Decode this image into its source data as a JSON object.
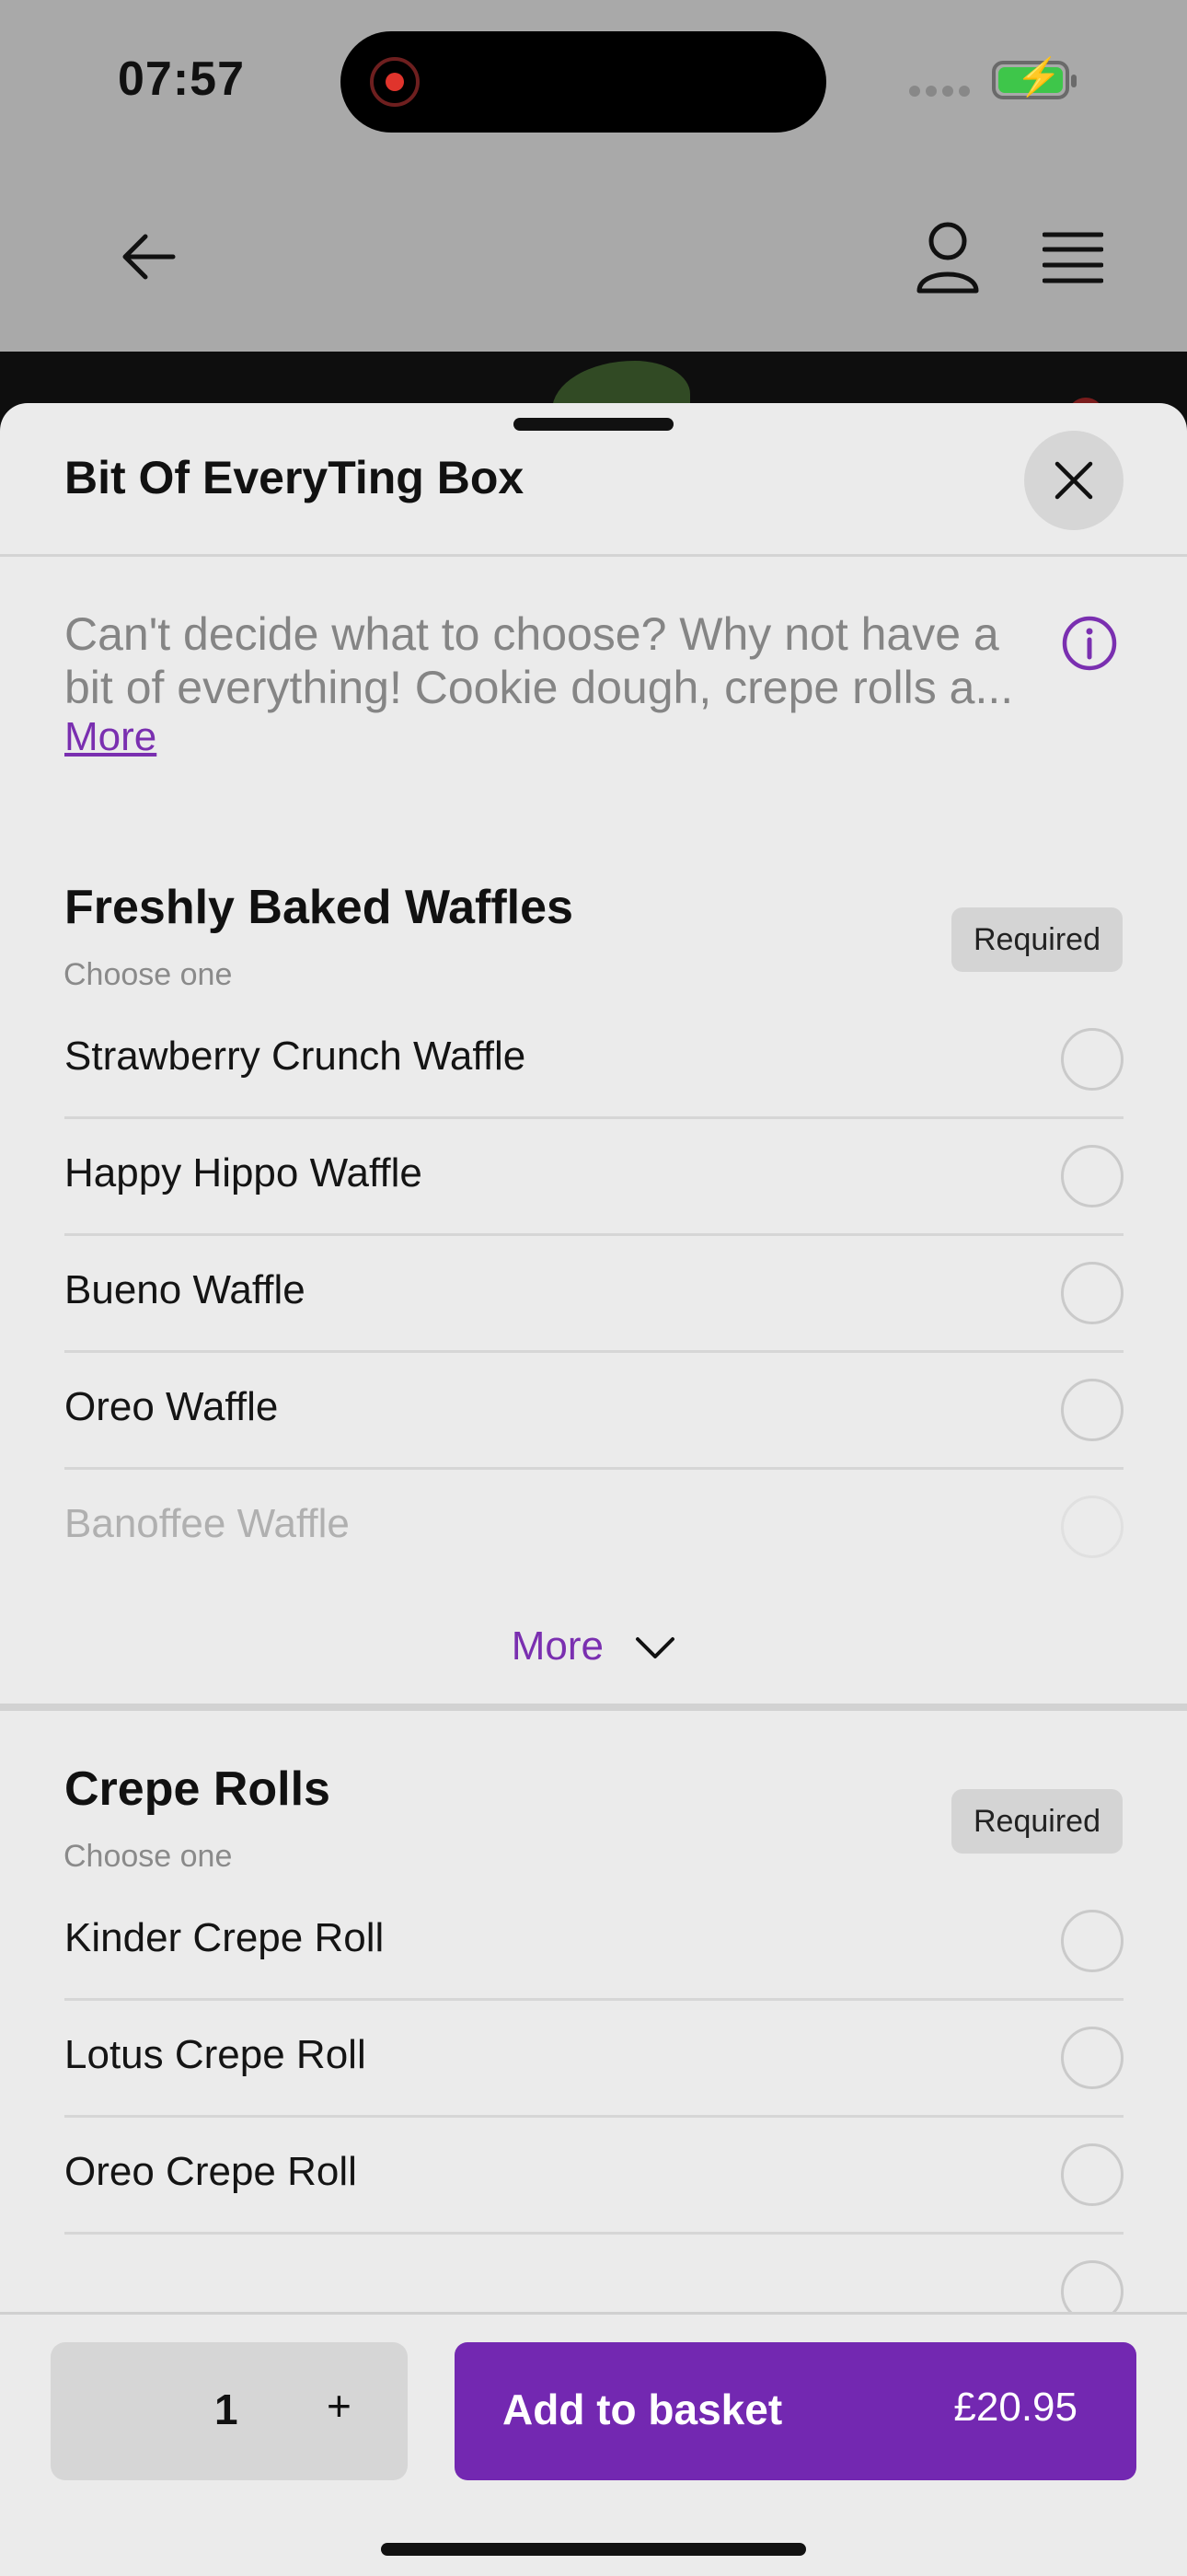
{
  "status": {
    "time": "07:57"
  },
  "sheet": {
    "title": "Bit Of EveryTing Box",
    "description": "Can't decide what to choose? Why not have a bit of everything! Cookie dough, crepe rolls a...",
    "more_link": "More"
  },
  "groups": [
    {
      "title": "Freshly Baked Waffles",
      "subtitle": "Choose one",
      "badge": "Required",
      "options": [
        "Strawberry Crunch Waffle",
        "Happy Hippo Waffle",
        "Bueno Waffle",
        "Oreo Waffle",
        "Banoffee Waffle"
      ],
      "more_label": "More"
    },
    {
      "title": "Crepe Rolls",
      "subtitle": "Choose one",
      "badge": "Required",
      "options": [
        "Kinder Crepe Roll",
        "Lotus Crepe Roll",
        "Oreo Crepe Roll"
      ]
    }
  ],
  "footer": {
    "quantity": "1",
    "plus": "+",
    "add_label": "Add to basket",
    "price": "£20.95"
  },
  "colors": {
    "accent": "#7328b1",
    "sheet_bg": "#ebebeb",
    "dim_bg": "#a9a9a9"
  },
  "icons": [
    "back-arrow-icon",
    "account-icon",
    "menu-icon",
    "close-icon",
    "info-icon",
    "chevron-down-icon",
    "battery-charging-icon",
    "screen-recording-icon"
  ]
}
